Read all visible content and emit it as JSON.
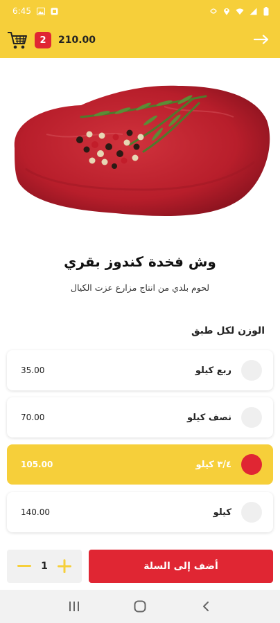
{
  "status_bar": {
    "time": "6:45",
    "icons_left": [
      "image-icon",
      "notification-icon"
    ],
    "icons_right": [
      "nfc-icon",
      "location-icon",
      "wifi-icon",
      "signal-icon",
      "battery-icon"
    ]
  },
  "header": {
    "back_icon": "arrow-left-icon",
    "cart_icon": "shopping-cart-icon",
    "cart_count": "2",
    "cart_total": "210.00",
    "accent_color": "#f6cf3a",
    "badge_color": "#e02633"
  },
  "product": {
    "image": "raw-beef-steak-with-rosemary-and-peppercorns",
    "title": "وش فخدة كندوز بقري",
    "subtitle": "لحوم بلدي من انتاج مزارع عزت الكيال"
  },
  "options_section": {
    "title": "الوزن لكل طبق",
    "options": [
      {
        "label": "ربع كيلو",
        "price": "35.00",
        "selected": false
      },
      {
        "label": "نصف كيلو",
        "price": "70.00",
        "selected": false
      },
      {
        "label": "٣/٤ كيلو",
        "price": "105.00",
        "selected": true
      },
      {
        "label": "كيلو",
        "price": "140.00",
        "selected": false
      }
    ]
  },
  "cart_actions": {
    "quantity": "1",
    "add_label": "أضف إلى السلة"
  },
  "nav": {
    "recents_icon": "recents-icon",
    "home_icon": "home-icon",
    "back_icon": "chevron-left-icon"
  }
}
